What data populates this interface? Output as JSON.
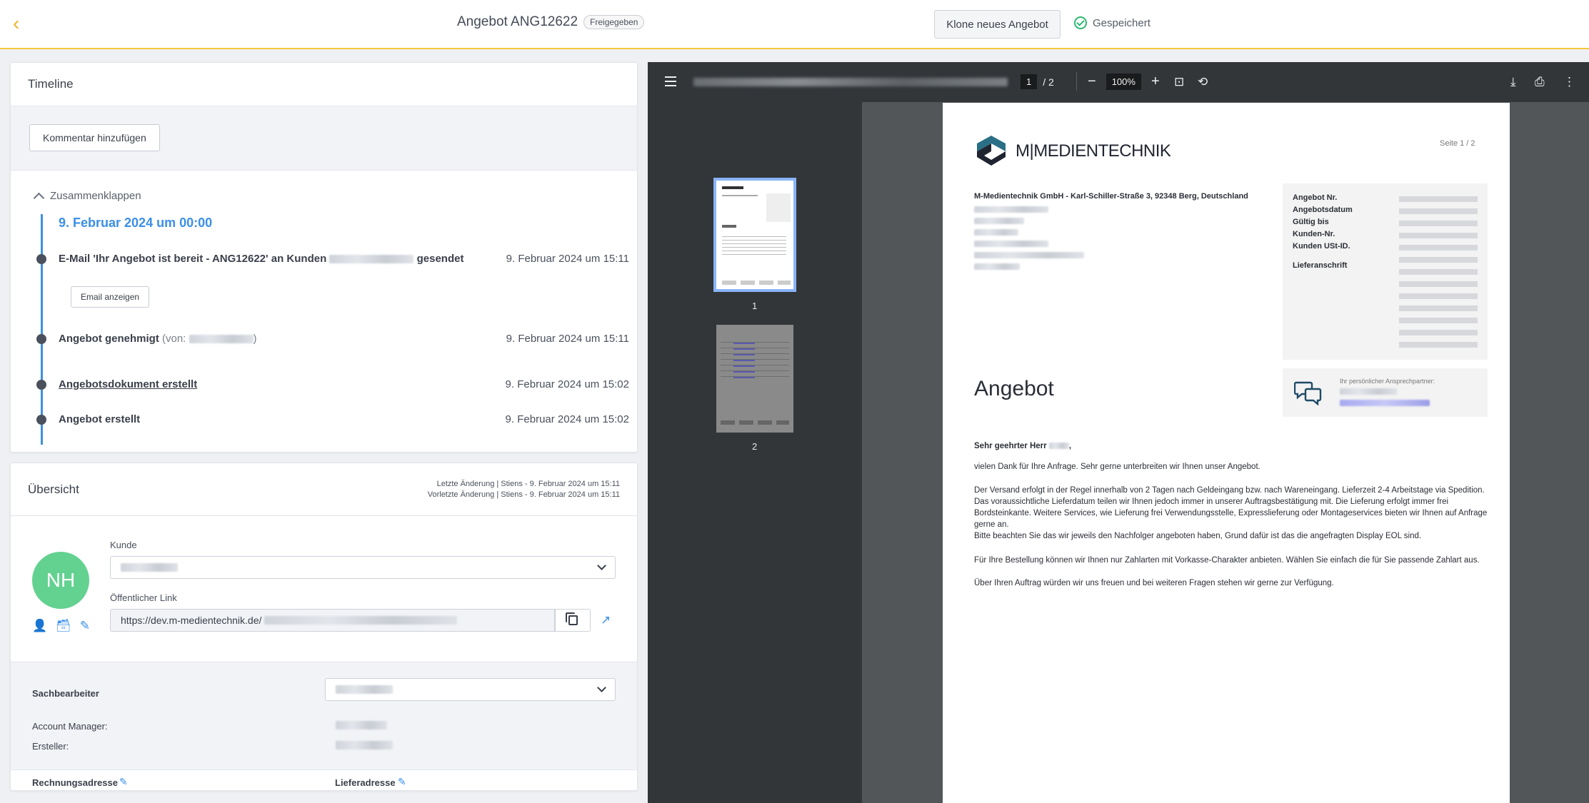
{
  "header": {
    "title": "Angebot ANG12622",
    "badge": "Freigegeben",
    "clone_label": "Klone neues Angebot",
    "saved_label": "Gespeichert"
  },
  "timeline": {
    "title": "Timeline",
    "comment_button": "Kommentar hinzufügen",
    "collapse_label": "Zusammenklappen",
    "date_heading": "9. Februar 2024 um 00:00",
    "email_button": "Email anzeigen",
    "items": [
      {
        "text_before": "E-Mail 'Ihr Angebot ist bereit - ANG12622' an Kunden",
        "text_after": "gesendet",
        "time": "9. Februar 2024 um 15:11"
      },
      {
        "text": "Angebot genehmigt",
        "muted": "(von:",
        "muted_end": ")",
        "time": "9. Februar 2024 um 15:11"
      },
      {
        "text": "Angebotsdokument erstellt",
        "time": "9. Februar 2024 um 15:02"
      },
      {
        "text": "Angebot erstellt",
        "time": "9. Februar 2024 um 15:02"
      }
    ]
  },
  "overview": {
    "title": "Übersicht",
    "last_change": "Letzte Änderung | Stiens - 9. Februar 2024 um 15:11",
    "prev_change": "Vorletzte Änderung | Stiens - 9. Februar 2024 um 15:11",
    "avatar_initials": "NH",
    "customer_label": "Kunde",
    "public_link_label": "Öffentlicher Link",
    "public_link_value": "https://dev.m-medientechnik.de/",
    "clerk_label": "Sachbearbeiter",
    "account_manager_label": "Account Manager:",
    "creator_label": "Ersteller:",
    "billing_label": "Rechnungsadresse",
    "delivery_label": "Lieferadresse"
  },
  "viewer": {
    "page_current": "1",
    "page_total": "/ 2",
    "zoom": "100%",
    "thumb_labels": [
      "1",
      "2"
    ]
  },
  "pdf": {
    "logo_text": "M|MEDIENTECHNIK",
    "page_label": "Seite 1 / 2",
    "sender_line": "M-Medientechnik GmbH - Karl-Schiller-Straße 3, 92348 Berg, Deutschland",
    "info_labels": [
      "Angebot Nr.",
      "Angebotsdatum",
      "Gültig bis",
      "Kunden-Nr.",
      "Kunden USt-ID."
    ],
    "delivery_label": "Lieferanschrift",
    "contact_label": "Ihr persönlicher Ansprechpartner:",
    "title": "Angebot",
    "salutation": "Sehr geehrter Herr",
    "para1": "vielen Dank für Ihre Anfrage. Sehr gerne unterbreiten wir Ihnen unser Angebot.",
    "para2a": "Der Versand erfolgt in der Regel innerhalb von 2 Tagen nach Geldeingang bzw. nach Wareneingang. Lieferzeit 2-4 Arbeitstage via Spedition.",
    "para2b": "Das voraussichtliche Lieferdatum teilen wir Ihnen jedoch immer in unserer Auftragsbestätigung mit. Die Lieferung erfolgt immer frei",
    "para2c": "Bordsteinkante. Weitere Services, wie Lieferung frei Verwendungsstelle, Expresslieferung oder Montageservices bieten wir Ihnen auf Anfrage",
    "para2d": "gerne an.",
    "para2e": "Bitte beachten Sie das wir jeweils den Nachfolger angeboten haben, Grund dafür ist das die angefragten Display EOL sind.",
    "para3": "Für Ihre Bestellung können wir Ihnen nur Zahlarten mit Vorkasse-Charakter anbieten. Wählen Sie einfach die für Sie passende Zahlart aus.",
    "para4": "Über Ihren Auftrag würden wir uns freuen und bei weiteren Fragen stehen wir gerne zur Verfügung."
  },
  "colors": {
    "accent": "#3a8fe8",
    "saved": "#2eb872",
    "avatar": "#63d190",
    "topbar_border": "#f3c63f"
  }
}
